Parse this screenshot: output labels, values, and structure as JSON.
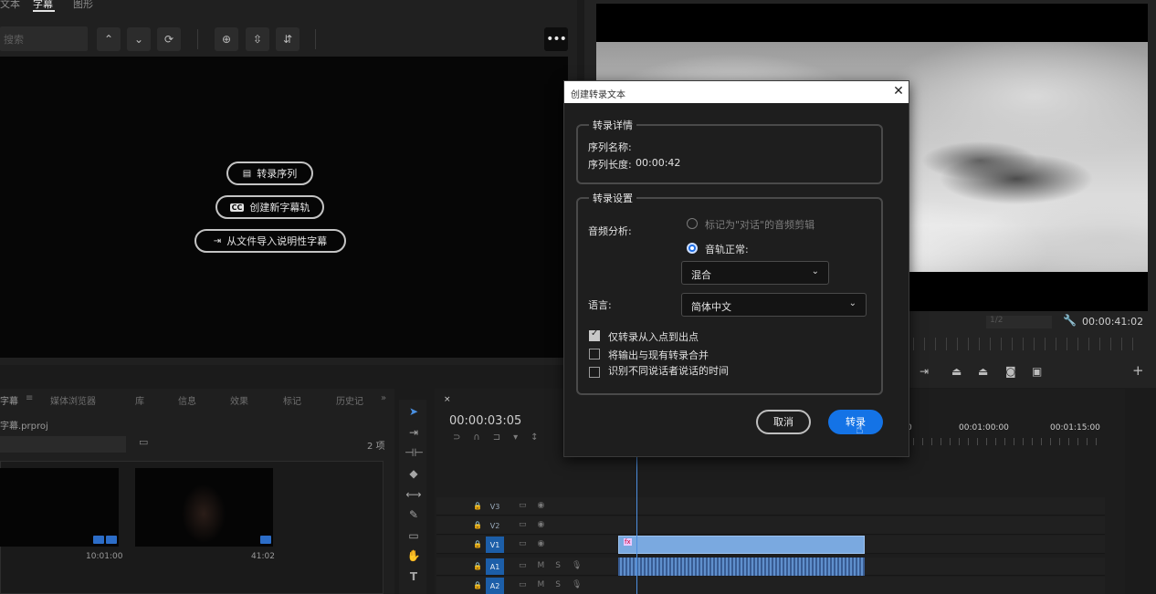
{
  "text_panel": {
    "tabs": [
      "文本",
      "字幕",
      "图形"
    ],
    "search_placeholder": "搜索",
    "actions": {
      "transcribe_sequence": "转录序列",
      "create_caption_track": "创建新字幕轨",
      "import_captions": "从文件导入说明性字幕"
    }
  },
  "program_monitor": {
    "timecode": "00:00:41:02",
    "fit": "1/2"
  },
  "project_panel": {
    "tabs": [
      "字幕",
      "媒体浏览器",
      "库",
      "信息",
      "效果",
      "标记",
      "历史记"
    ],
    "filename": "字幕.prproj",
    "item_count": "2 项",
    "items": [
      {
        "duration": "10:01:00"
      },
      {
        "duration": "41:02"
      }
    ]
  },
  "timeline": {
    "timecode": "00:00:03:05",
    "ruler_times": [
      "00:01:00:00",
      "00:01:15:00"
    ],
    "tracks": [
      "V3",
      "V2",
      "V1",
      "A1",
      "A2"
    ],
    "clip_badge": "fx"
  },
  "dialog": {
    "title": "创建转录文本",
    "details": {
      "heading": "转录详情",
      "sequence_name_label": "序列名称:",
      "sequence_length_label": "序列长度:",
      "sequence_length_value": "00:00:42"
    },
    "settings": {
      "heading": "转录设置",
      "audio_analysis_label": "音频分析:",
      "option_dialogue": "标记为\"对话\"的音频剪辑",
      "option_track": "音轨正常:",
      "track_select": "混合",
      "language_label": "语言:",
      "language_select": "简体中文",
      "check_in_out": "仅转录从入点到出点",
      "check_merge": "将输出与现有转录合并",
      "check_speakers": "识别不同说话者说话的时间"
    },
    "buttons": {
      "cancel": "取消",
      "transcribe": "转录"
    }
  },
  "colors": {
    "accent": "#1473e6",
    "clip_video": "#7aa9e0",
    "track_selected": "#1c5ea8"
  }
}
